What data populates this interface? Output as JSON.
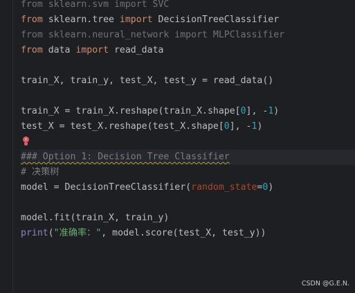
{
  "editor": {
    "lines": {
      "l1": "from sklearn.svm import SVC",
      "l2a": "from",
      "l2b": " sklearn.tree ",
      "l2c": "import",
      "l2d": " DecisionTreeClassifier",
      "l3": "from sklearn.neural_network import MLPClassifier",
      "l4a": "from",
      "l4b": " data ",
      "l4c": "import",
      "l4d": " read_data",
      "l6": "train_X, train_y, test_X, test_y = read_data()",
      "l8a": "train_X = train_X.reshape(train_X.shape[",
      "l8b": "0",
      "l8c": "], -",
      "l8d": "1",
      "l8e": ")",
      "l9a": "test_X = test_X.reshape(test_X.shape[",
      "l9b": "0",
      "l9c": "], -",
      "l9d": "1",
      "l9e": ")",
      "l11": "### Option 1: Decision Tree Classifier",
      "l12": "# 决策树",
      "l13a": "model = DecisionTreeClassifier(",
      "l13b": "random_state",
      "l13c": "=",
      "l13d": "0",
      "l13e": ")",
      "l15": "model.fit(train_X, train_y)",
      "l16a": "print",
      "l16b": "(",
      "l16c": "\"准确率：\"",
      "l16d": ", model.score(test_X, test_y))"
    },
    "intention_icon": "red-lightbulb-icon"
  },
  "watermark": "CSDN @G.E.N."
}
